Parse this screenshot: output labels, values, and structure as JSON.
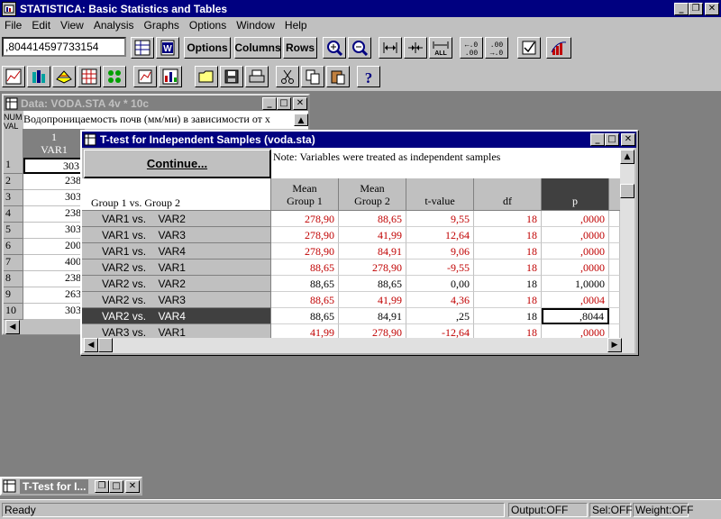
{
  "app": {
    "title": "STATISTICA: Basic Statistics and Tables"
  },
  "menu": [
    "File",
    "Edit",
    "View",
    "Analysis",
    "Graphs",
    "Options",
    "Window",
    "Help"
  ],
  "toolbar": {
    "cell_value": ",804414597733154",
    "options_label": "Options",
    "columns_label": "Columns",
    "rows_label": "Rows"
  },
  "datawin": {
    "title": "Data: VODA.STA 4v * 10c",
    "header_text": "Водопроницаемость почв (мм/ми) в зависимости от х",
    "corner_label1": "NUM",
    "corner_label2": "VAL",
    "col_index": "1",
    "col_name": "VAR1",
    "rows": [
      {
        "n": "1",
        "v": "303"
      },
      {
        "n": "2",
        "v": "238"
      },
      {
        "n": "3",
        "v": "303"
      },
      {
        "n": "4",
        "v": "238"
      },
      {
        "n": "5",
        "v": "303"
      },
      {
        "n": "6",
        "v": "200"
      },
      {
        "n": "7",
        "v": "400"
      },
      {
        "n": "8",
        "v": "238"
      },
      {
        "n": "9",
        "v": "263"
      },
      {
        "n": "10",
        "v": "303"
      }
    ]
  },
  "ttest": {
    "title": "T-test for Independent Samples (voda.sta)",
    "continue_label": "Continue...",
    "note": "Note: Variables were treated as independent samples",
    "group_header": "Group 1  vs. Group 2",
    "col_mean1_a": "Mean",
    "col_mean1_b": "Group 1",
    "col_mean2_a": "Mean",
    "col_mean2_b": "Group 2",
    "col_t": "t-value",
    "col_df": "df",
    "col_p": "p",
    "rows": [
      {
        "label": "VAR1 vs.    VAR2",
        "m1": "278,90",
        "m2": "88,65",
        "t": "9,55",
        "df": "18",
        "p": ",0000",
        "sig": true
      },
      {
        "label": "VAR1 vs.    VAR3",
        "m1": "278,90",
        "m2": "41,99",
        "t": "12,64",
        "df": "18",
        "p": ",0000",
        "sig": true
      },
      {
        "label": "VAR1 vs.    VAR4",
        "m1": "278,90",
        "m2": "84,91",
        "t": "9,06",
        "df": "18",
        "p": ",0000",
        "sig": true
      },
      {
        "label": "VAR2 vs.    VAR1",
        "m1": "88,65",
        "m2": "278,90",
        "t": "-9,55",
        "df": "18",
        "p": ",0000",
        "sig": true
      },
      {
        "label": "VAR2 vs.    VAR2",
        "m1": "88,65",
        "m2": "88,65",
        "t": "0,00",
        "df": "18",
        "p": "1,0000",
        "sig": false
      },
      {
        "label": "VAR2 vs.    VAR3",
        "m1": "88,65",
        "m2": "41,99",
        "t": "4,36",
        "df": "18",
        "p": ",0004",
        "sig": true
      },
      {
        "label": "VAR2 vs.    VAR4",
        "m1": "88,65",
        "m2": "84,91",
        "t": ",25",
        "df": "18",
        "p": ",8044",
        "sig": false,
        "selected": true
      },
      {
        "label": "VAR3 vs.    VAR1",
        "m1": "41,99",
        "m2": "278,90",
        "t": "-12,64",
        "df": "18",
        "p": ",0000",
        "sig": true
      }
    ]
  },
  "minimized": {
    "title": "T-Test for I..."
  },
  "status": {
    "ready": "Ready",
    "output": "Output:OFF",
    "sel": "Sel:OFF",
    "weight": "Weight:OFF"
  }
}
